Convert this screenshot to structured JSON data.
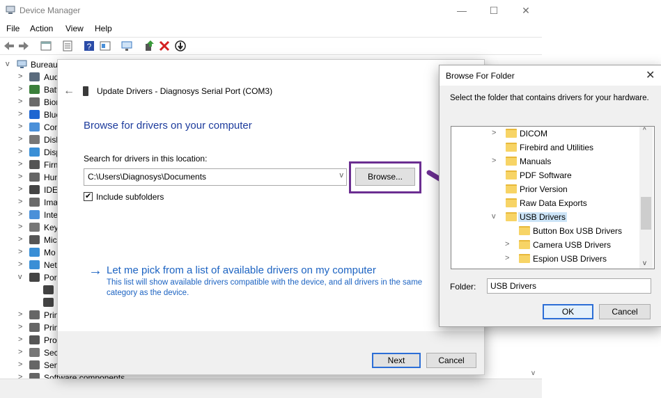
{
  "device_manager": {
    "title": "Device Manager",
    "controls": {
      "minimize": "—",
      "maximize": "☐",
      "close": "✕"
    },
    "menu": [
      "File",
      "Action",
      "View",
      "Help"
    ],
    "root": "Bureau",
    "tree_items": [
      {
        "label": "Aud",
        "chev": ">",
        "icon_color": "#5a6b7d"
      },
      {
        "label": "Batt",
        "chev": ">",
        "icon_color": "#3b7f3b"
      },
      {
        "label": "Bion",
        "chev": ">",
        "icon_color": "#6a6a6a"
      },
      {
        "label": "Blue",
        "chev": ">",
        "icon_color": "#1f66d1"
      },
      {
        "label": "Com",
        "chev": ">",
        "icon_color": "#4a90d9"
      },
      {
        "label": "Disk",
        "chev": ">",
        "icon_color": "#777777"
      },
      {
        "label": "Disp",
        "chev": ">",
        "icon_color": "#3a8fd6"
      },
      {
        "label": "Firm",
        "chev": ">",
        "icon_color": "#555555"
      },
      {
        "label": "Hum",
        "chev": ">",
        "icon_color": "#666666"
      },
      {
        "label": "IDE",
        "chev": ">",
        "icon_color": "#444444"
      },
      {
        "label": "Ima",
        "chev": ">",
        "icon_color": "#6a6a6a"
      },
      {
        "label": "Inte",
        "chev": ">",
        "icon_color": "#4a90d9"
      },
      {
        "label": "Key",
        "chev": ">",
        "icon_color": "#777777"
      },
      {
        "label": "Mic",
        "chev": ">",
        "icon_color": "#555555"
      },
      {
        "label": "Mo",
        "chev": ">",
        "icon_color": "#3a8fd6"
      },
      {
        "label": "Net",
        "chev": ">",
        "icon_color": "#3a8fd6"
      },
      {
        "label": "Por",
        "chev": "v",
        "icon_color": "#444444"
      },
      {
        "label": "",
        "chev": "",
        "icon_color": "#444444"
      },
      {
        "label": "",
        "chev": "",
        "icon_color": "#444444"
      },
      {
        "label": "Prin",
        "chev": ">",
        "icon_color": "#666666"
      },
      {
        "label": "Prin",
        "chev": ">",
        "icon_color": "#666666"
      },
      {
        "label": "Pro",
        "chev": ">",
        "icon_color": "#555555"
      },
      {
        "label": "Sec",
        "chev": ">",
        "icon_color": "#777777"
      },
      {
        "label": "Sen",
        "chev": ">",
        "icon_color": "#666666"
      },
      {
        "label": "Software components",
        "chev": ">",
        "icon_color": "#666666"
      }
    ]
  },
  "update_drivers": {
    "back_glyph": "←",
    "title": "Update Drivers - Diagnosys Serial Port (COM3)",
    "heading": "Browse for drivers on your computer",
    "search_label": "Search for drivers in this location:",
    "path_value": "C:\\Users\\Diagnosys\\Documents",
    "browse_label": "Browse...",
    "include_subfolders_label": "Include subfolders",
    "include_subfolders_checked": true,
    "pick_arrow": "→",
    "pick_link": "Let me pick from a list of available drivers on my computer",
    "pick_desc": "This list will show available drivers compatible with the device, and all drivers in the same category as the device.",
    "next_label": "Next",
    "cancel_label": "Cancel"
  },
  "browse_folder": {
    "title": "Browse For Folder",
    "close_glyph": "✕",
    "instruction": "Select the folder that contains drivers for your hardware.",
    "folders": [
      {
        "label": "DICOM",
        "chev": ">",
        "indent": 0
      },
      {
        "label": "Firebird and Utilities",
        "chev": "",
        "indent": 0
      },
      {
        "label": "Manuals",
        "chev": ">",
        "indent": 0
      },
      {
        "label": "PDF Software",
        "chev": "",
        "indent": 0
      },
      {
        "label": "Prior Version",
        "chev": "",
        "indent": 0
      },
      {
        "label": "Raw Data Exports",
        "chev": "",
        "indent": 0
      },
      {
        "label": "USB Drivers",
        "chev": "v",
        "indent": 0,
        "selected": true
      },
      {
        "label": "Button Box USB Drivers",
        "chev": "",
        "indent": 1
      },
      {
        "label": "Camera USB Drivers",
        "chev": ">",
        "indent": 1
      },
      {
        "label": "Espion USB Drivers",
        "chev": ">",
        "indent": 1
      }
    ],
    "folder_label": "Folder:",
    "folder_value": "USB Drivers",
    "ok_label": "OK",
    "cancel_label": "Cancel"
  },
  "colors": {
    "link_blue": "#1c63c2",
    "heading_blue": "#1c3b9c",
    "highlight_purple": "#6b2e91"
  }
}
